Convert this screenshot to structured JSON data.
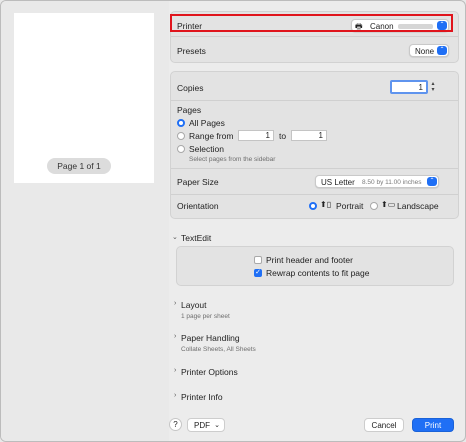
{
  "preview": {
    "page_indicator": "Page 1 of 1"
  },
  "printer": {
    "label": "Printer",
    "value": "Canon"
  },
  "presets": {
    "label": "Presets",
    "value": "None"
  },
  "copies": {
    "label": "Copies",
    "value": "1"
  },
  "pages": {
    "label": "Pages",
    "all_pages": "All Pages",
    "range_from": "Range from",
    "range_start": "1",
    "to": "to",
    "range_end": "1",
    "selection": "Selection",
    "selection_hint": "Select pages from the sidebar"
  },
  "paper_size": {
    "label": "Paper Size",
    "value": "US Letter",
    "detail": "8.50 by 11.00 inches"
  },
  "orientation": {
    "label": "Orientation",
    "portrait": "Portrait",
    "landscape": "Landscape"
  },
  "textedit": {
    "title": "TextEdit",
    "print_header_footer": "Print header and footer",
    "rewrap": "Rewrap contents to fit page"
  },
  "sections": [
    {
      "title": "Layout",
      "subtitle": "1 page per sheet"
    },
    {
      "title": "Paper Handling",
      "subtitle": "Collate Sheets, All Sheets"
    },
    {
      "title": "Printer Options",
      "subtitle": ""
    },
    {
      "title": "Printer Info",
      "subtitle": ""
    }
  ],
  "footer": {
    "help": "?",
    "pdf": "PDF",
    "cancel": "Cancel",
    "print": "Print"
  },
  "colors": {
    "accent": "#1f6ff5",
    "highlight_border": "#e0141c"
  }
}
